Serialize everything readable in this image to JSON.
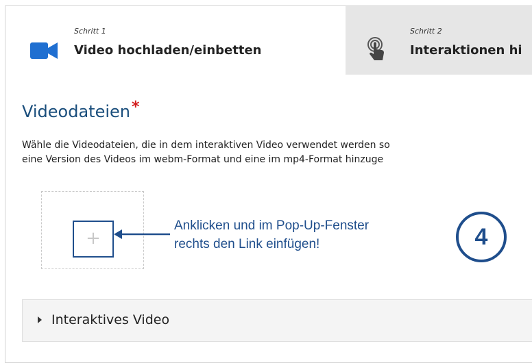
{
  "tabs": [
    {
      "step": "Schritt 1",
      "title": "Video hochladen/einbetten",
      "icon": "video-camera-icon"
    },
    {
      "step": "Schritt 2",
      "title": "Interaktionen hi",
      "icon": "hand-pointer-icon"
    }
  ],
  "section": {
    "title": "Videodateien",
    "required_mark": "*",
    "description_lines": [
      "Wähle die Videodateien, die in dem interaktiven Video verwendet werden so",
      "eine Version des Videos im webm-Format und eine im mp4-Format hinzuge"
    ]
  },
  "add_button": {
    "label": "+"
  },
  "annotation": {
    "lines": [
      "Anklicken und im Pop-Up-Fenster",
      "rechts den Link einfügen!"
    ],
    "step_number": "4"
  },
  "collapsible": {
    "label": "Interaktives Video",
    "icon": "caret-right-icon"
  },
  "colors": {
    "accent": "#1f4e8c",
    "title": "#1a4e7c",
    "required": "#d31d1d",
    "inactive_tab": "#e6e6e6"
  }
}
